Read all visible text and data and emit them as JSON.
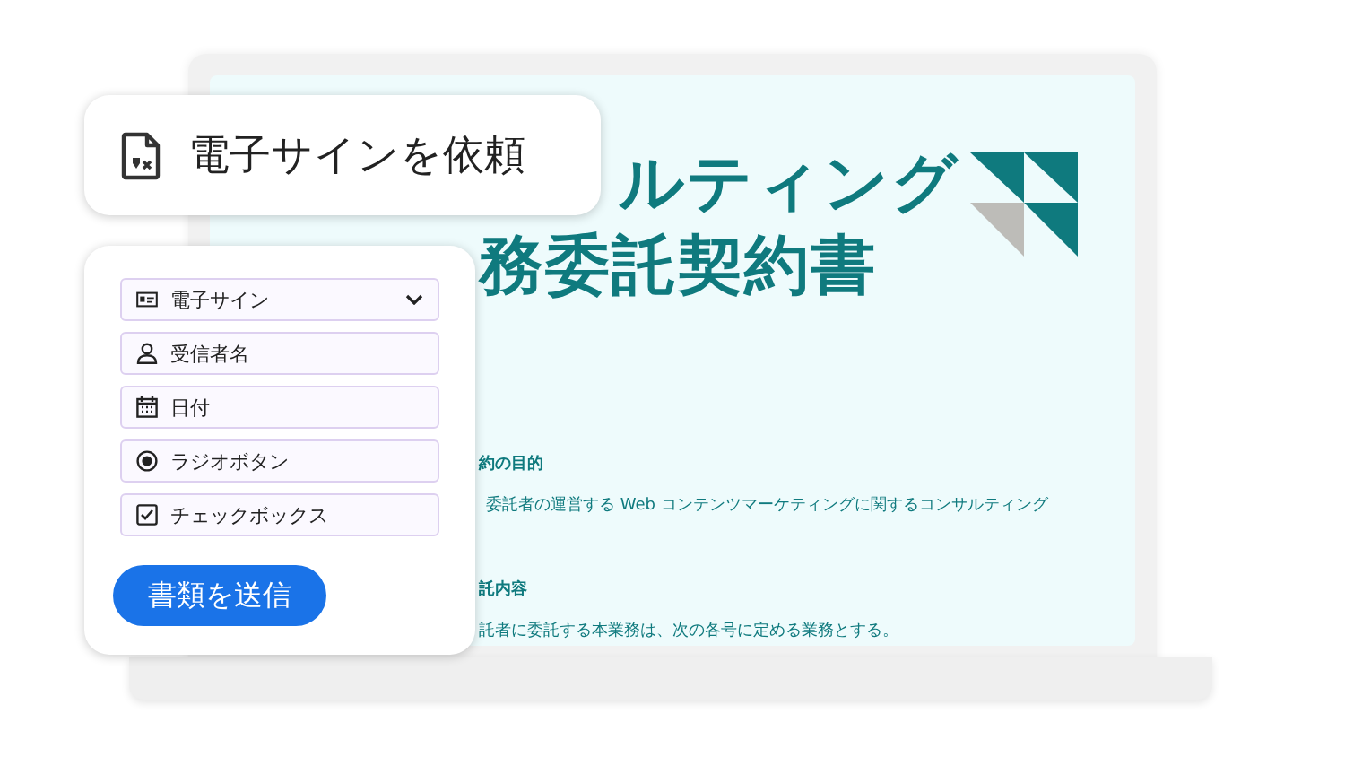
{
  "document": {
    "title_lines": [
      "ルティング",
      "務委託契約書"
    ],
    "sections": [
      {
        "heading": "約の目的",
        "body": "委託者の運営する Web コンテンツマーケティングに関するコンサルティング"
      },
      {
        "heading": "託内容",
        "body": "託者に委託する本業務は、次の各号に定める業務とする。"
      }
    ]
  },
  "request_card": {
    "label": "電子サインを依頼"
  },
  "form": {
    "fields": [
      {
        "kind": "select",
        "label": "電子サイン"
      },
      {
        "kind": "person",
        "label": "受信者名"
      },
      {
        "kind": "date",
        "label": "日付"
      },
      {
        "kind": "radio",
        "label": "ラジオボタン"
      },
      {
        "kind": "checkbox",
        "label": "チェックボックス"
      }
    ],
    "submit": "書類を送信"
  }
}
